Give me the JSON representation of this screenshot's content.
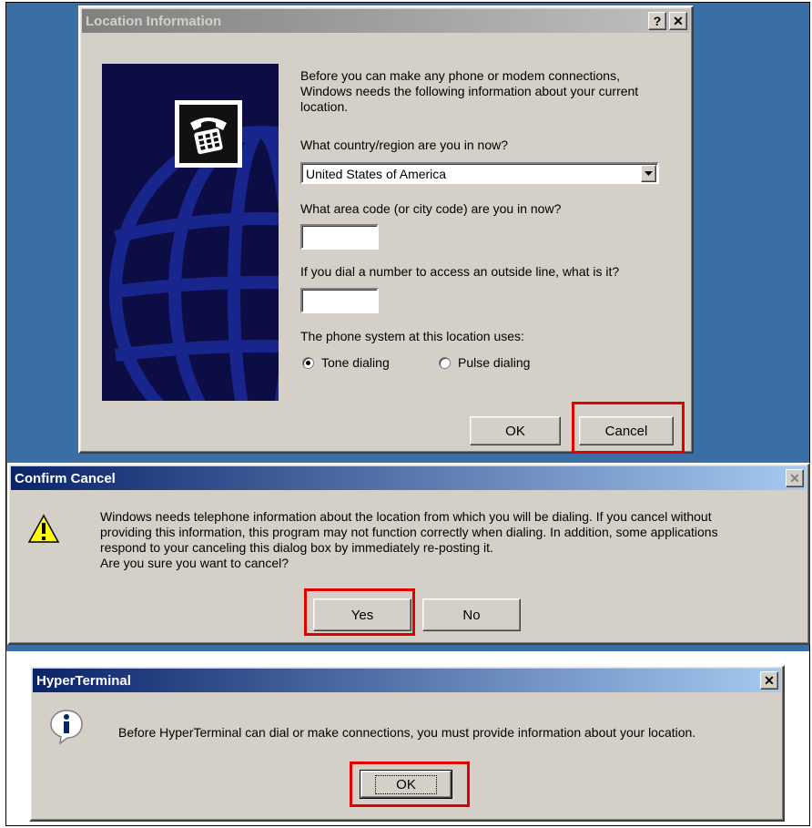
{
  "location_dialog": {
    "title": "Location Information",
    "help_button": "?",
    "close_button": "✕",
    "intro": "Before you can make any phone or modem connections, Windows needs the following information about your current location.",
    "country_label": "What country/region are you in now?",
    "country_value": "United States of America",
    "area_code_label": "What area code (or city code) are you in now?",
    "area_code_value": "",
    "outside_line_label": "If you dial a number to access an outside line, what is it?",
    "outside_line_value": "",
    "phone_system_label": "The phone system at this location uses:",
    "tone_label": "Tone dialing",
    "pulse_label": "Pulse dialing",
    "selected_dialing": "tone",
    "ok_label": "OK",
    "cancel_label": "Cancel"
  },
  "confirm_dialog": {
    "title": "Confirm Cancel",
    "close_button": "✕",
    "message_line1": "Windows needs telephone information about the location from which you will be dialing. If you cancel without",
    "message_line2": "providing this information, this program may not function correctly when dialing. In addition, some applications",
    "message_line3": "respond to your canceling this dialog box by immediately re-posting it.",
    "question": "Are you sure you want to cancel?",
    "yes_label": "Yes",
    "no_label": "No",
    "icon": "warning-icon"
  },
  "hyperterminal_dialog": {
    "title": "HyperTerminal",
    "close_button": "✕",
    "message": "Before HyperTerminal can dial or make connections, you must provide information about your location.",
    "ok_label": "OK",
    "icon": "info-icon"
  },
  "colors": {
    "desktop": "#3a6ea5",
    "active_title": "#0a246a",
    "inactive_title": "#808080",
    "dialog_face": "#d4d0c8",
    "highlight": "#e00000"
  }
}
